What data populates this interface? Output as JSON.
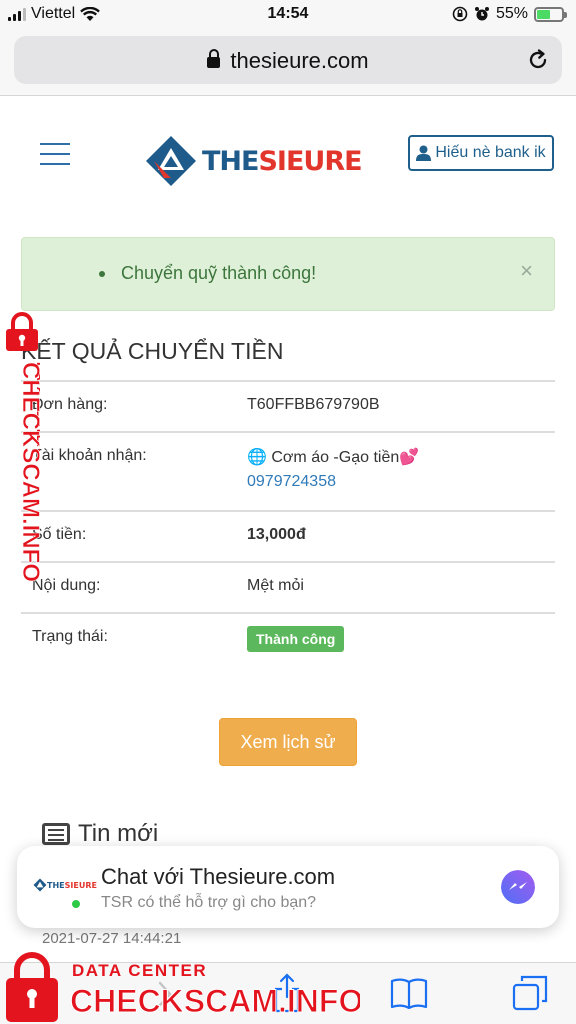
{
  "status_bar": {
    "carrier": "Viettel",
    "time": "14:54",
    "battery": "55%",
    "battery_level": 0.55
  },
  "browser": {
    "url": "thesieure.com"
  },
  "header": {
    "logo_part1": "THE",
    "logo_part2": "SIEURE",
    "account_label": "Hiếu nè bank ik"
  },
  "alert": {
    "message": "Chuyển quỹ thành công!",
    "close": "×"
  },
  "result": {
    "title": "KẾT QUẢ CHUYỂN TIỀN",
    "rows": [
      {
        "label": "Đơn hàng:",
        "value": "T60FFBB679790B"
      },
      {
        "label": "Tài khoản nhận:",
        "value": "🌐 Cơm áo -Gạo tiền💕",
        "phone": "0979724358"
      },
      {
        "label": "Số tiền:",
        "value": "13,000đ"
      },
      {
        "label": "Nội dung:",
        "value": "Mệt mỏi"
      },
      {
        "label": "Trạng thái:",
        "value": "Thành công"
      }
    ],
    "history_button": "Xem lịch sử"
  },
  "news": {
    "title": "Tin mới",
    "date": "2021-07-27 14:44:21"
  },
  "chat_widget": {
    "title": "Chat với Thesieure.com",
    "subtitle": "TSR có thể hỗ trợ gì cho bạn?",
    "logo_part1": "THE",
    "logo_part2": "SIEURE"
  },
  "watermark": {
    "line1": "DATA CENTER",
    "line2": "CHECKSCAM.INFO"
  },
  "colors": {
    "brand_blue": "#1e5a8a",
    "brand_red": "#e2362d",
    "success_green": "#5cb85c",
    "warning_orange": "#f0ad4e",
    "watermark_red": "#e3141e"
  }
}
